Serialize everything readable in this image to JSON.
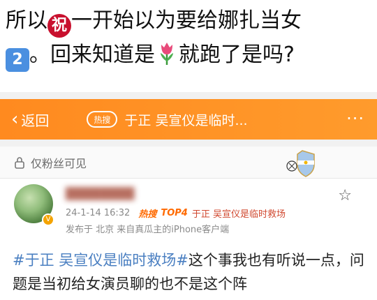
{
  "caption": {
    "line1_a": "所以",
    "line1_badge": "祝",
    "line1_b": "一开始以为要给娜扎当女",
    "line2_badge": "2",
    "line2_a": "。回来知道是",
    "line2_b": "就跑了是吗?"
  },
  "topbar": {
    "back_label": "返回",
    "hot_chip": "热搜",
    "topic": "于正 吴宣仪是临时...",
    "more": "···",
    "accent": "#ff8a1f"
  },
  "privacy": {
    "text": "仅粉丝可见"
  },
  "post": {
    "meta_time": "24-1-14 16:32",
    "hot_tag": "热搜",
    "top_tag": "TOP4",
    "meta_topic": "于正 吴宣仪是临时救场",
    "meta_source": "发布于 北京  来自真瓜主的iPhone客户端",
    "body_topic": "#于正 吴宣仪是临时救场#",
    "body_text": "这个事我也有听说一点，问题是当初给女演员聊的也不是这个阵"
  }
}
